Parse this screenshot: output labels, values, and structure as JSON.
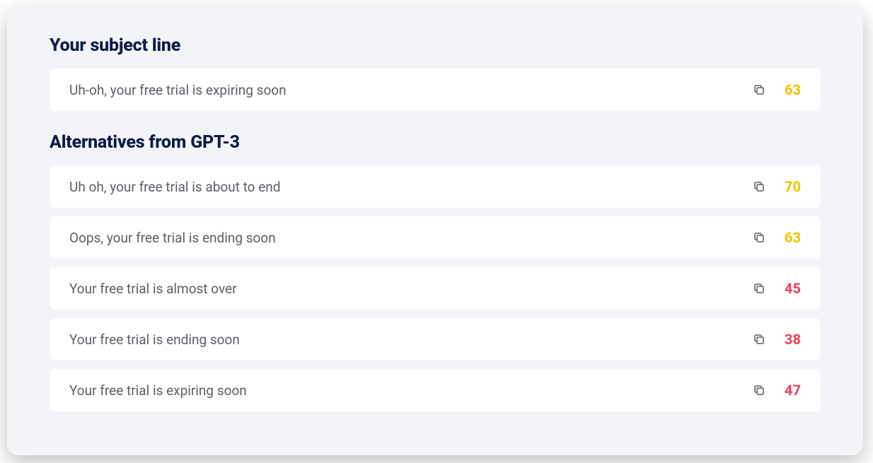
{
  "sections": {
    "your_subject": {
      "heading": "Your subject line",
      "item": {
        "text": "Uh-oh, your free trial is expiring soon",
        "score": 63,
        "score_class": "score-yellow"
      }
    },
    "alternatives": {
      "heading": "Alternatives from GPT-3",
      "items": [
        {
          "text": "Uh oh, your free trial is about to end",
          "score": 70,
          "score_class": "score-yellow"
        },
        {
          "text": "Oops, your free trial is ending soon",
          "score": 63,
          "score_class": "score-yellow"
        },
        {
          "text": "Your free trial is almost over",
          "score": 45,
          "score_class": "score-red"
        },
        {
          "text": "Your free trial is ending soon",
          "score": 38,
          "score_class": "score-red"
        },
        {
          "text": "Your free trial is expiring soon",
          "score": 47,
          "score_class": "score-red"
        }
      ]
    }
  }
}
